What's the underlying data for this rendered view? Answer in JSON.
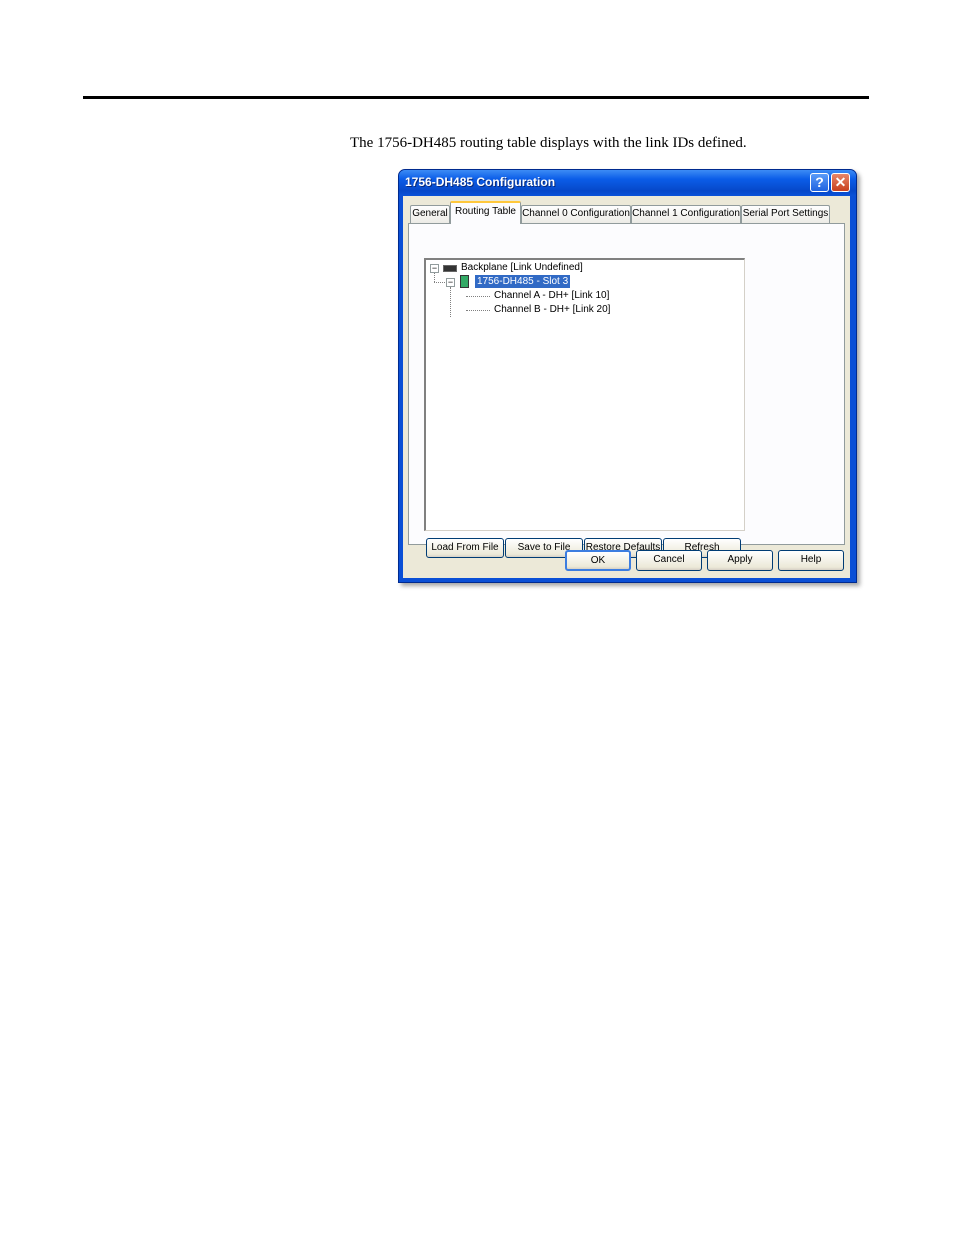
{
  "caption": "The 1756-DH485 routing table displays with the link IDs defined.",
  "dialog": {
    "title": "1756-DH485 Configuration",
    "help_glyph": "?",
    "close_glyph": "✕",
    "tabs": [
      "General",
      "Routing Table",
      "Channel 0 Configuration",
      "Channel 1 Configuration",
      "Serial Port Settings"
    ],
    "active_tab": "Routing Table",
    "tree": {
      "root": "Backplane [Link Undefined]",
      "module": "1756-DH485 - Slot 3",
      "channels": [
        "Channel A - DH+ [Link 10]",
        "Channel B - DH+ [Link 20]"
      ]
    },
    "table_buttons": {
      "load": "Load From File",
      "save": "Save to File",
      "restore": "Restore Defaults",
      "refresh": "Refresh"
    },
    "dialog_buttons": {
      "ok": "OK",
      "cancel": "Cancel",
      "apply": "Apply",
      "help": "Help"
    }
  }
}
